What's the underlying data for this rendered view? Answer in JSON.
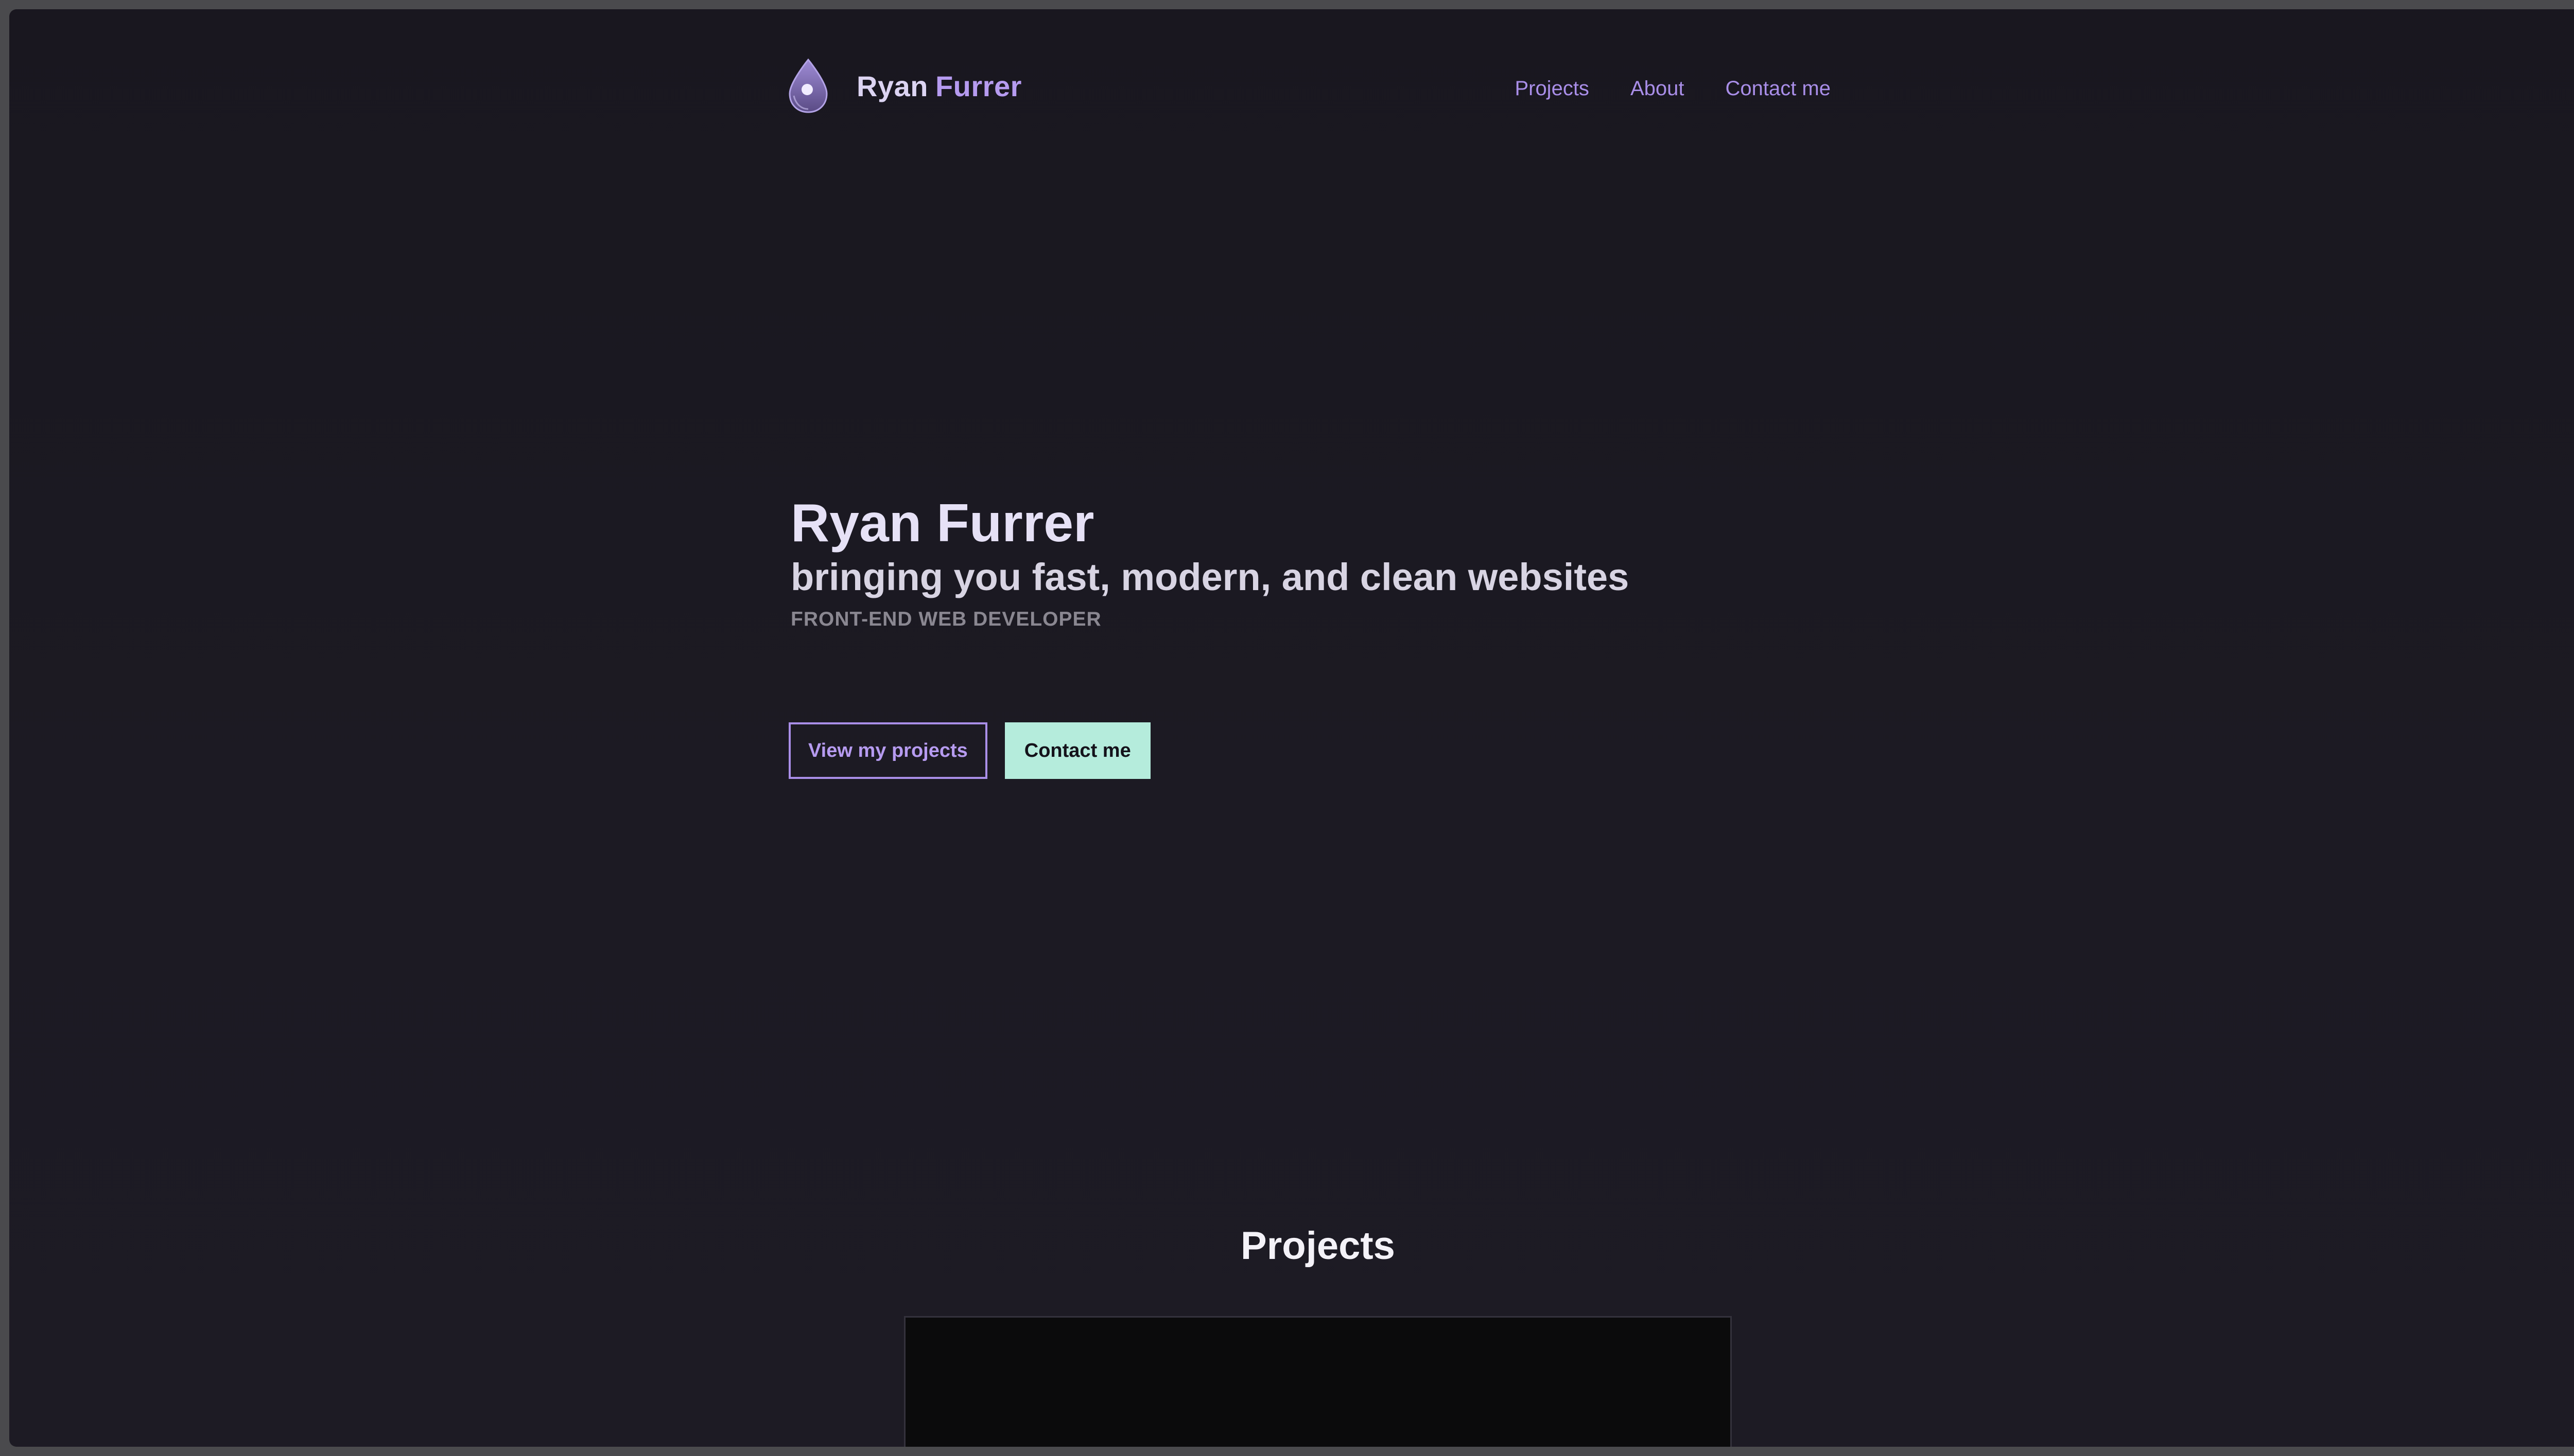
{
  "colors": {
    "background": "#1b1922",
    "accent": "#b69bf0",
    "accent_green": "#b5ecdc",
    "text_light": "#e6e1f6",
    "text_muted": "#8a8791"
  },
  "header": {
    "logo_icon": "water-drop-icon",
    "logo_first": "Ryan",
    "logo_last": "Furrer",
    "nav": [
      {
        "label": "Projects"
      },
      {
        "label": "About"
      },
      {
        "label": "Contact me"
      }
    ]
  },
  "hero": {
    "name": "Ryan Furrer",
    "tagline": "bringing you fast, modern, and clean websites",
    "role": "FRONT-END WEB DEVELOPER",
    "buttons": {
      "primary_label": "View my projects",
      "secondary_label": "Contact me"
    }
  },
  "projects": {
    "title": "Projects"
  }
}
